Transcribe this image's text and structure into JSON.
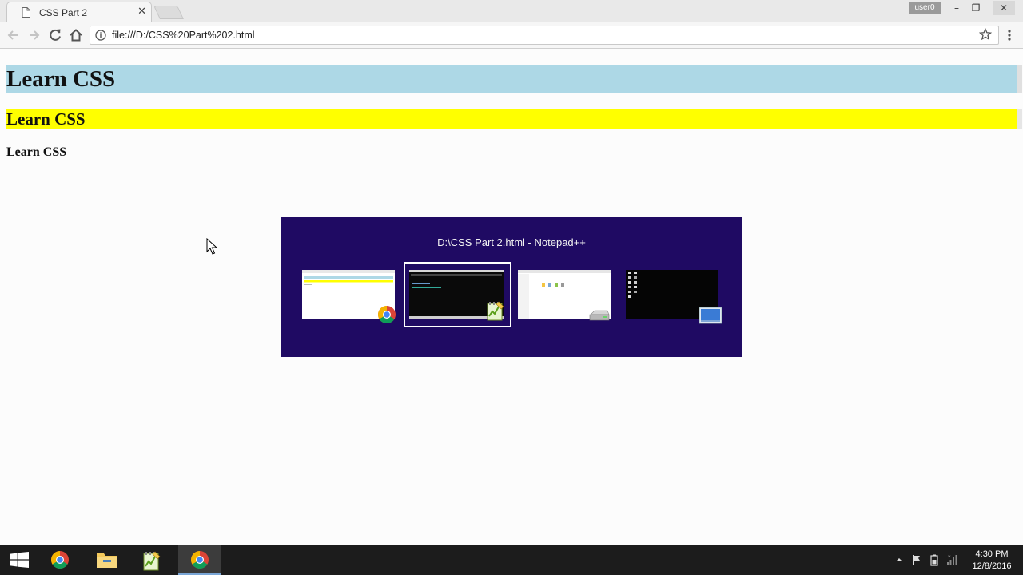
{
  "browser": {
    "tab_title": "CSS Part 2",
    "url": "file:///D:/CSS%20Part%202.html",
    "user_badge": "user0",
    "window_controls": {
      "minimize": "–",
      "restore": "❐",
      "close": "✕"
    },
    "tab_close": "✕"
  },
  "page": {
    "h1": "Learn CSS",
    "h2": "Learn CSS",
    "h4": "Learn CSS",
    "colors": {
      "h1_bg": "#add8e6",
      "h2_bg": "#ffff00"
    }
  },
  "switcher": {
    "title": "D:\\CSS Part 2.html - Notepad++",
    "windows": [
      {
        "app": "chrome-icon",
        "selected": false
      },
      {
        "app": "notepad-plus-plus-icon",
        "selected": true
      },
      {
        "app": "drive-icon",
        "selected": false
      },
      {
        "app": "desktop-icon",
        "selected": false
      }
    ],
    "bg": "#1f0a63"
  },
  "taskbar": {
    "items": [
      "windows-start-icon",
      "chrome-icon",
      "file-explorer-icon",
      "notepad-plus-plus-icon",
      "chrome-icon"
    ],
    "time": "4:30 PM",
    "date": "12/8/2016"
  }
}
